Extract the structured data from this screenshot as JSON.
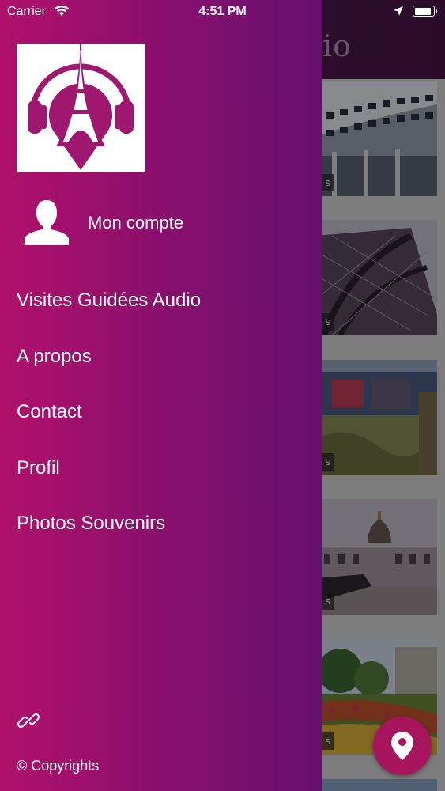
{
  "status_bar": {
    "carrier": "Carrier",
    "time": "4:51 PM"
  },
  "background_app": {
    "title_fragment": "io",
    "card_tag": "s",
    "cards": [
      {
        "scene": "modern-building"
      },
      {
        "scene": "eiffel-tower"
      },
      {
        "scene": "museum-garden"
      },
      {
        "scene": "invalides-courtyard"
      },
      {
        "scene": "flower-park"
      }
    ],
    "fab_icon": "map-pin-icon"
  },
  "drawer": {
    "logo_icon": "eiffel-headphones-logo",
    "account": {
      "icon": "user-silhouette-icon",
      "label": "Mon compte"
    },
    "menu": [
      {
        "label": "Visites Guidées Audio"
      },
      {
        "label": "A propos"
      },
      {
        "label": "Contact"
      },
      {
        "label": "Profil"
      },
      {
        "label": "Photos Souvenirs"
      }
    ],
    "footer": {
      "link_icon": "link-icon",
      "copyright": "© Copyrights"
    }
  },
  "colors": {
    "drawer_gradient_start": "#b1116b",
    "drawer_gradient_end": "#66106e",
    "accent": "#a6155d",
    "logo_purple": "#a01770"
  }
}
